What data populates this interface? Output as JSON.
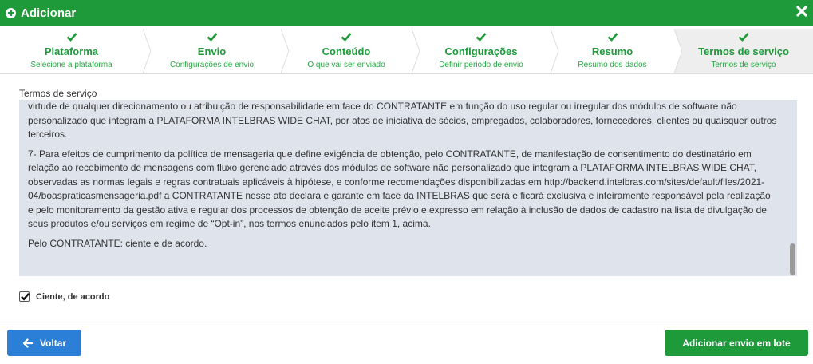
{
  "header": {
    "title": "Adicionar",
    "plus_icon": "plus-circle-icon",
    "close_icon": "close-icon"
  },
  "steps": [
    {
      "label": "Plataforma",
      "sub": "Selecione a plataforma",
      "status": "done"
    },
    {
      "label": "Envio",
      "sub": "Configurações de envio",
      "status": "done"
    },
    {
      "label": "Conteúdo",
      "sub": "O que vai ser enviado",
      "status": "done"
    },
    {
      "label": "Configurações",
      "sub": "Definir periodo de envio",
      "status": "done"
    },
    {
      "label": "Resumo",
      "sub": "Resumo dos dados",
      "status": "done"
    },
    {
      "label": "Termos de serviço",
      "sub": "Termos de serviço",
      "status": "active"
    }
  ],
  "terms": {
    "label": "Termos de serviço",
    "paragraphs": [
      "virtude de qualquer direcionamento ou atribuição de responsabilidade em face do CONTRATANTE em função do uso regular ou irregular dos módulos de software não personalizado que integram a PLATAFORMA INTELBRAS WIDE CHAT, por atos de iniciativa de sócios, empregados, colaboradores, fornecedores, clientes ou quaisquer outros terceiros.",
      "7- Para efeitos de cumprimento da política de mensageria que define exigência de obtenção, pelo CONTRATANTE, de manifestação de consentimento do destinatário em relação ao recebimento de mensagens com fluxo gerenciado através dos módulos de software não personalizado que integram a PLATAFORMA INTELBRAS WIDE CHAT, observadas as normas legais e regras contratuais aplicáveis à hipótese, e conforme recomendações disponibilizadas em http://backend.intelbras.com/sites/default/files/2021-04/boaspraticasmensageria.pdf a CONTRATANTE nesse ato declara e garante em face da INTELBRAS que será e ficará exclusiva e inteiramente responsável pela realização e pelo monitoramento da gestão ativa e regular dos processos de obtenção de aceite prévio e expresso em relação à inclusão de dados de cadastro na lista de divulgação de seus produtos e/ou serviços em regime de “Opt-in”, nos termos enunciados pelo item 1, acima.",
      "Pelo CONTRATANTE: ciente e de acordo."
    ]
  },
  "agree": {
    "label": "Ciente, de acordo",
    "checked": true
  },
  "footer": {
    "back_label": "Voltar",
    "submit_label": "Adicionar envio em lote"
  },
  "colors": {
    "brand": "#1e9a3a",
    "primary": "#2b7fd6",
    "terms_bg": "#dfe3ec"
  }
}
